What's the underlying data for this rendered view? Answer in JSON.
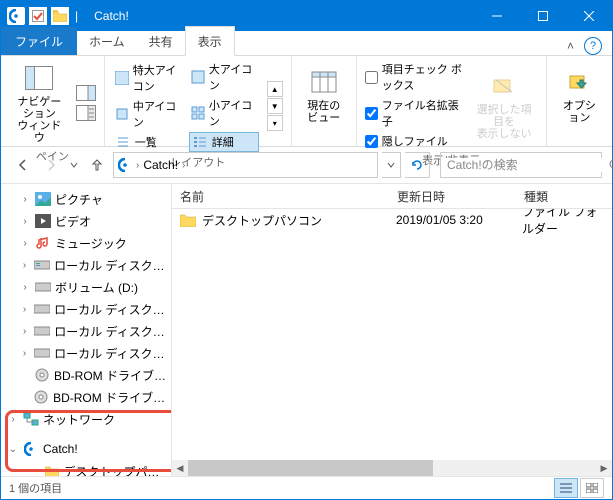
{
  "window": {
    "title": "Catch!"
  },
  "tabs": {
    "file": "ファイル",
    "home": "ホーム",
    "share": "共有",
    "view": "表示"
  },
  "ribbon": {
    "pane": {
      "nav": "ナビゲーション\nウィンドウ",
      "label": "ペイン"
    },
    "layout": {
      "xlarge": "特大アイコン",
      "large": "大アイコン",
      "medium": "中アイコン",
      "small": "小アイコン",
      "list": "一覧",
      "details": "詳細",
      "label": "レイアウト"
    },
    "current_view": {
      "btn": "現在の\nビュー",
      "label": ""
    },
    "showhide": {
      "checkboxes": "項目チェック ボックス",
      "extensions": "ファイル名拡張子",
      "hidden": "隠しファイル",
      "hide_selected": "選択した項目を\n表示しない",
      "label": "表示/非表示"
    },
    "options": {
      "btn": "オプション"
    }
  },
  "address": {
    "crumb1": "Catch!",
    "search_placeholder": "Catch!の検索"
  },
  "columns": {
    "name": "名前",
    "modified": "更新日時",
    "type": "種類"
  },
  "items": [
    {
      "name": "デスクトップパソコン",
      "modified": "2019/01/05 3:20",
      "type": "ファイル フォルダー"
    }
  ],
  "tree": {
    "pictures": "ピクチャ",
    "videos": "ビデオ",
    "music": "ミュージック",
    "localC": "ローカル ディスク (C:)",
    "volD": "ボリューム (D:)",
    "localE": "ローカル ディスク (E:)",
    "localF": "ローカル ディスク (F:)",
    "localG": "ローカル ディスク (G:)",
    "bdH": "BD-ROM ドライブ (H:)",
    "bdH2": "BD-ROM ドライブ (H:) U",
    "network": "ネットワーク",
    "catch": "Catch!",
    "desktop_pc": "デスクトップパソコン"
  },
  "status": {
    "count": "1 個の項目"
  }
}
